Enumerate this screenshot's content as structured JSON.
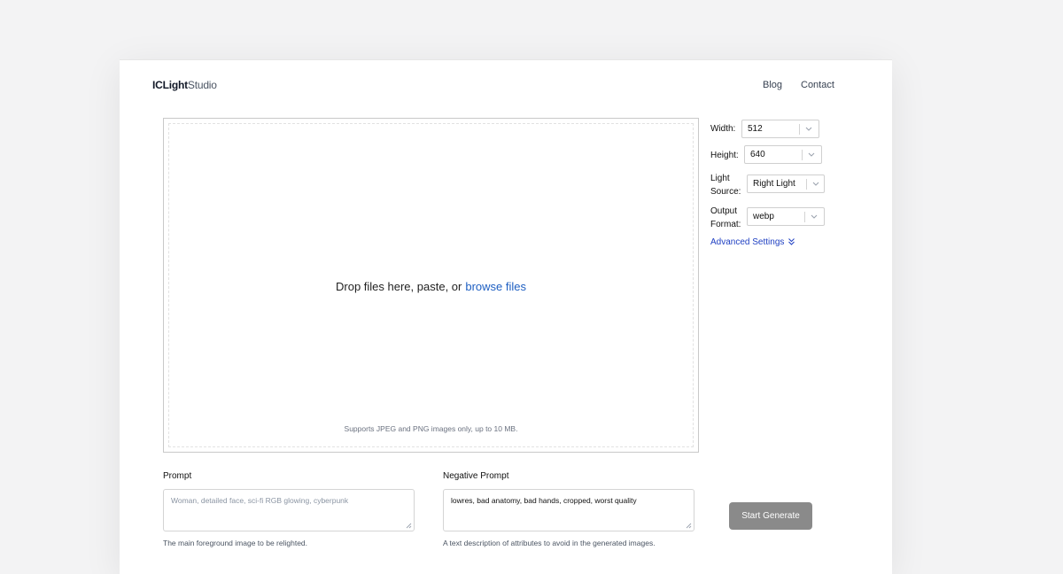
{
  "header": {
    "logo_part1": "ICLight",
    "logo_part2": "Studio",
    "nav": [
      "Blog",
      "Contact"
    ]
  },
  "upload": {
    "lead_text": "Drop files here, paste, or",
    "browse_text": "browse files",
    "support_text": "Supports JPEG and PNG images only, up to 10 MB."
  },
  "settings": {
    "width": {
      "label": "Width:",
      "value": "512"
    },
    "height": {
      "label": "Height:",
      "value": "640"
    },
    "light_source": {
      "label_line1": "Light",
      "label_line2": "Source:",
      "value": "Right Light"
    },
    "output_format": {
      "label_line1": "Output",
      "label_line2": "Format:",
      "value": "webp"
    },
    "advanced": "Advanced Settings"
  },
  "prompt": {
    "label": "Prompt",
    "placeholder": "Woman, detailed face, sci-fi RGB glowing, cyberpunk",
    "help": "The main foreground image to be relighted."
  },
  "negative_prompt": {
    "label": "Negative Prompt",
    "value": "lowres, bad anatomy, bad hands, cropped, worst quality",
    "help": "A text description of attributes to avoid in the generated images."
  },
  "actions": {
    "generate_label": "Start Generate"
  },
  "icons": {
    "select_chevron": "chevron-down-icon",
    "advanced_chevron": "double-chevron-down-icon",
    "resize_grip": "resize-grip-icon"
  },
  "colors": {
    "accent_link": "#1e5fc2",
    "advanced_link": "#1e3fc2",
    "button_bg": "#8a8a8a",
    "page_bg": "#f3f3f4"
  }
}
